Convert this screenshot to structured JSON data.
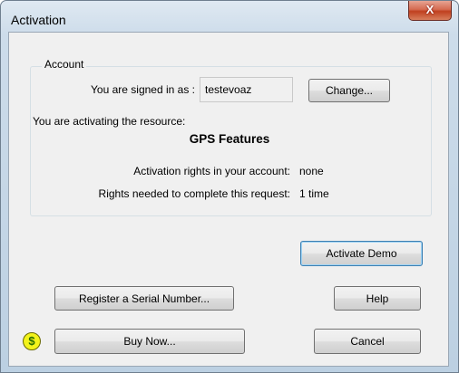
{
  "window": {
    "title": "Activation",
    "close_glyph": "X"
  },
  "account": {
    "legend": "Account",
    "signed_in_label": "You are signed in as :",
    "username": "testevoaz",
    "change_button": "Change..."
  },
  "resource": {
    "activating_label": "You are activating the resource:",
    "name": "GPS Features",
    "rights_account_label": "Activation rights in your account:",
    "rights_account_value": "none",
    "rights_needed_label": "Rights needed to complete this request:",
    "rights_needed_value": "1 time"
  },
  "buttons": {
    "activate_demo": "Activate Demo",
    "register_serial": "Register a Serial Number...",
    "help": "Help",
    "buy_now": "Buy Now...",
    "cancel": "Cancel"
  },
  "icons": {
    "dollar_glyph": "$"
  }
}
